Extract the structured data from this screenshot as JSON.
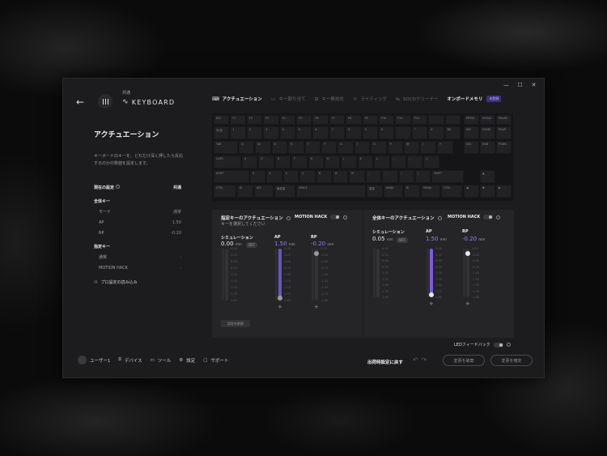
{
  "window": {
    "controls": [
      "—",
      "☐",
      "✕"
    ]
  },
  "brand": {
    "sub": "共通",
    "name": "KEYBOARD"
  },
  "tabs": [
    {
      "label": "アクチュエーション",
      "icon": "⌨"
    },
    {
      "label": "キー割り当て",
      "icon": "▭"
    },
    {
      "label": "キー無効化",
      "icon": "⊟"
    },
    {
      "label": "ライティング",
      "icon": "☼"
    },
    {
      "label": "SOCDクリーナー",
      "icon": "⇆"
    },
    {
      "label": "オンボードメモリ",
      "icon": ""
    }
  ],
  "onboard_badge": "未登録",
  "sidebar": {
    "title": "アクチュエーション",
    "description": "キーボードのキーを、どれだけ深く押したら反応するのかの数値を設定します。",
    "current_setting_label": "現在の設定",
    "current_setting_value": "共通",
    "all_keys_label": "全体キー",
    "mode_label": "モード",
    "mode_value": "通常",
    "ap_label": "AP",
    "ap_value": "1.50",
    "rp_label": "RP",
    "rp_value": "-0.20",
    "specified_keys_label": "指定キー",
    "normal_label": "通常",
    "normal_value": "-",
    "motion_hack_label": "MOTION HACK",
    "motion_hack_value": "-",
    "load_pro": "プロ設定の読み込み"
  },
  "keyboard": {
    "row0": [
      "ESC",
      "F1",
      "F2",
      "F3",
      "F4",
      "F5",
      "F6",
      "F7",
      "F8",
      "F9",
      "F10",
      "F11",
      "F12",
      "",
      ""
    ],
    "row1": [
      "半/全",
      "1",
      "2",
      "3",
      "4",
      "5",
      "6",
      "7",
      "8",
      "9",
      "0",
      "-",
      "^",
      "¥",
      "BS"
    ],
    "row2": [
      "TAB",
      "Q",
      "W",
      "E",
      "R",
      "T",
      "Y",
      "U",
      "I",
      "O",
      "P",
      "@",
      "[",
      "↵"
    ],
    "row3": [
      "CAPS",
      "A",
      "S",
      "D",
      "F",
      "G",
      "H",
      "J",
      "K",
      "L",
      ";",
      ":",
      "]"
    ],
    "row4": [
      "SHIFT",
      "Z",
      "X",
      "C",
      "V",
      "B",
      "N",
      "M",
      ",",
      ".",
      "/",
      "\\",
      "SHIFT"
    ],
    "row5": [
      "CTRL",
      "⊞",
      "ALT",
      "無変換",
      "SPACE",
      "変換",
      "KANA",
      "⊞",
      "MENU",
      "CTRL"
    ],
    "nav_top": [
      "PRTSC",
      "SCRLK",
      "PAUSE"
    ],
    "nav_mid": [
      "INS",
      "HOME",
      "PGUP"
    ],
    "nav_low": [
      "DEL",
      "END",
      "PGDN"
    ],
    "arrows": [
      "▲",
      "◀",
      "▼",
      "▶"
    ]
  },
  "left_panel": {
    "title": "指定キーのアクチュエーション",
    "subtitle": "キーを選択してください",
    "motion_hack": "MOTION HACK",
    "sim_label": "シミュレーション",
    "sim_value": "0.00",
    "unit": "mm",
    "off": "OFF",
    "ap_label": "AP",
    "ap_value": "1.50",
    "rp_label": "RP",
    "rp_value": "-0.20",
    "reset": "設定を削除"
  },
  "right_panel": {
    "title": "全体キーのアクチュエーション",
    "motion_hack": "MOTION HACK",
    "sim_label": "シミュレーション",
    "sim_value": "0.05",
    "unit": "mm",
    "off": "OFF",
    "ap_label": "AP",
    "ap_value": "1.50",
    "rp_label": "RP",
    "rp_value": "-0.20"
  },
  "scales": {
    "sim": [
      "0.00",
      "0.25",
      "0.50",
      "0.75",
      "1.00",
      "1.25",
      "1.50",
      "1.75",
      "1.80"
    ],
    "ap": [
      "0.00",
      "0.25",
      "0.50",
      "0.75",
      "1.00",
      "1.25",
      "1.50",
      "1.75",
      "1.80"
    ],
    "rp": [
      "0.00",
      "-0.20",
      "-0.50",
      "-0.75",
      "-1.00",
      "-1.25",
      "-1.50",
      "-1.75",
      "-1.80"
    ]
  },
  "led_label": "LEDフィードバック",
  "footer": {
    "user": "ユーザー1",
    "device": "デバイス",
    "tool": "ツール",
    "settings": "設定",
    "support": "サポート",
    "reset_default": "出荷時設定に戻す",
    "discard": "変更を破棄",
    "confirm": "変更を確定"
  },
  "colors": {
    "accent": "#7b5be0",
    "accent_text": "#9a7bff",
    "panel": "#252527",
    "window": "#1c1c1e"
  }
}
